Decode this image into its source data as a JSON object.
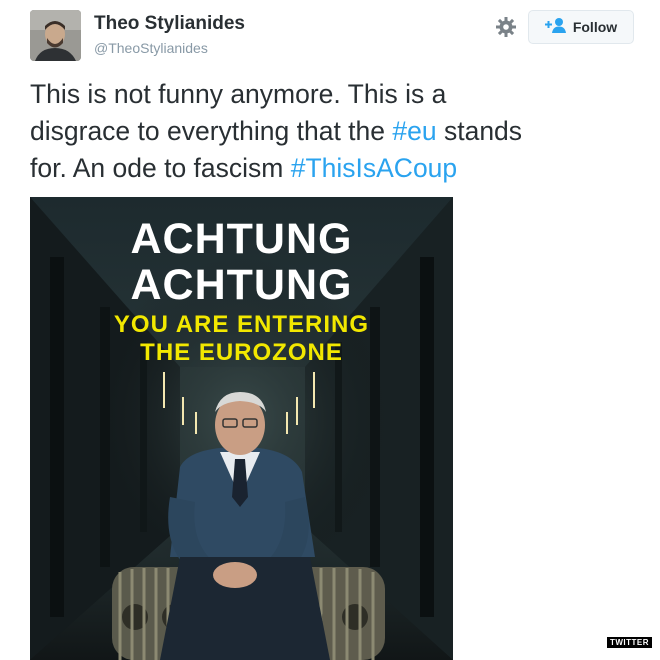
{
  "author": {
    "name": "Theo Stylianides",
    "handle": "@TheoStylianides"
  },
  "actions": {
    "follow_label": "Follow",
    "settings_icon": "gear-icon",
    "follow_icon": "add-user-icon"
  },
  "tweet": {
    "line1": "This is not funny anymore. This is a",
    "line2_pre": "disgrace to everything that the ",
    "hashtag1": "#eu",
    "line2_post": " stands",
    "line3_pre": "for. An ode to fascism ",
    "hashtag2": "#ThisIsACoup"
  },
  "image": {
    "headline_1": "ACHTUNG",
    "headline_2": "ACHTUNG",
    "sub_1": "YOU ARE ENTERING",
    "sub_2": "THE EUROZONE"
  },
  "watermark": "TWITTER",
  "colors": {
    "hashtag": "#2aa3ef",
    "poster_yellow": "#f2e800",
    "text": "#292f33",
    "muted": "#8899a6"
  }
}
